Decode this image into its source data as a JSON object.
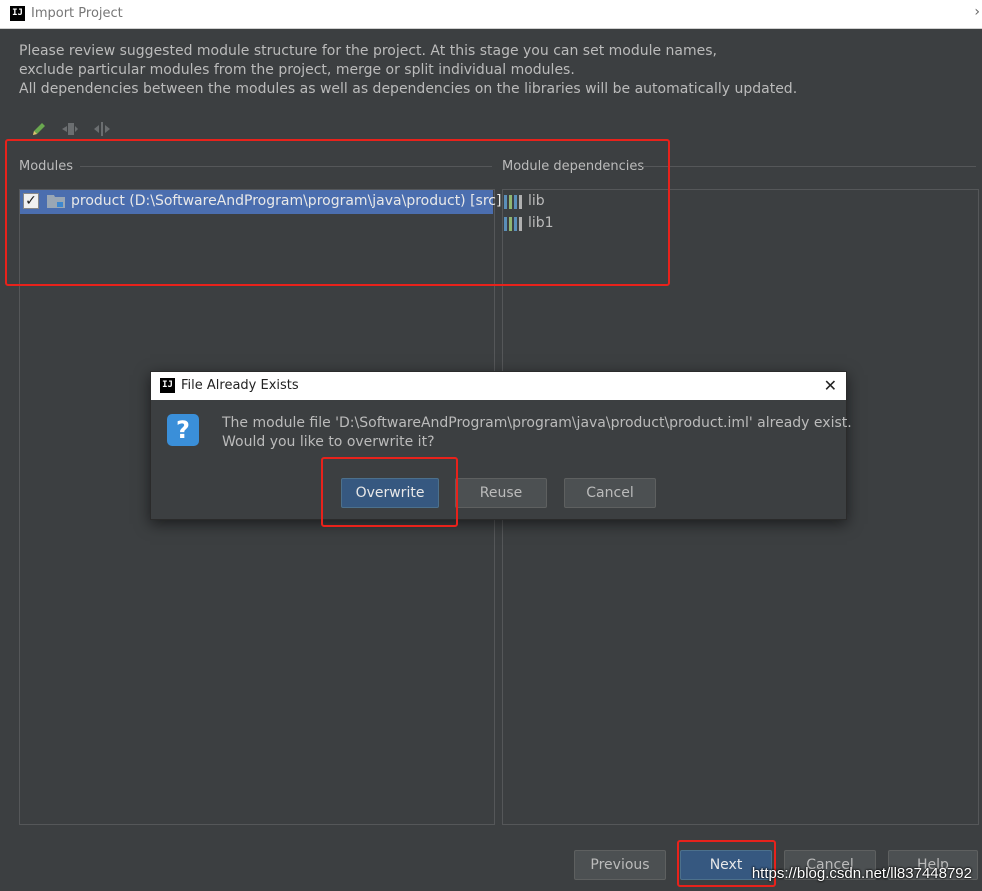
{
  "window": {
    "title": "Import Project",
    "app_icon_text": "IJ",
    "chevron": "›"
  },
  "description": {
    "line1": "Please review suggested module structure for the project. At this stage you can set module names,",
    "line2": "exclude particular modules from the project, merge or split individual modules.",
    "line3": "All dependencies between the modules as well as dependencies on the libraries will be automatically updated."
  },
  "toolbar": {
    "icons": [
      "edit-icon",
      "merge-icon",
      "split-icon"
    ]
  },
  "modules": {
    "header": "Modules",
    "items": [
      {
        "label": "product (D:\\SoftwareAndProgram\\program\\java\\product) [src]",
        "checked": true
      }
    ]
  },
  "dependencies": {
    "header": "Module dependencies",
    "items": [
      {
        "label": "lib"
      },
      {
        "label": "lib1"
      }
    ]
  },
  "dialog": {
    "title": "File Already Exists",
    "app_icon_text": "IJ",
    "close": "✕",
    "icon": "?",
    "message_line1": "The module file 'D:\\SoftwareAndProgram\\program\\java\\product\\product.iml' already exist.",
    "message_line2": "Would you like to overwrite it?",
    "buttons": {
      "overwrite": "Overwrite",
      "reuse": "Reuse",
      "cancel": "Cancel"
    }
  },
  "footer": {
    "previous": "Previous",
    "next": "Next",
    "cancel": "Cancel",
    "help": "Help"
  },
  "watermark": "https://blog.csdn.net/ll837448792",
  "colors": {
    "background": "#3c3f41",
    "selection": "#4b6eaf",
    "primary_button": "#365880",
    "highlight_box": "#e8221b"
  }
}
